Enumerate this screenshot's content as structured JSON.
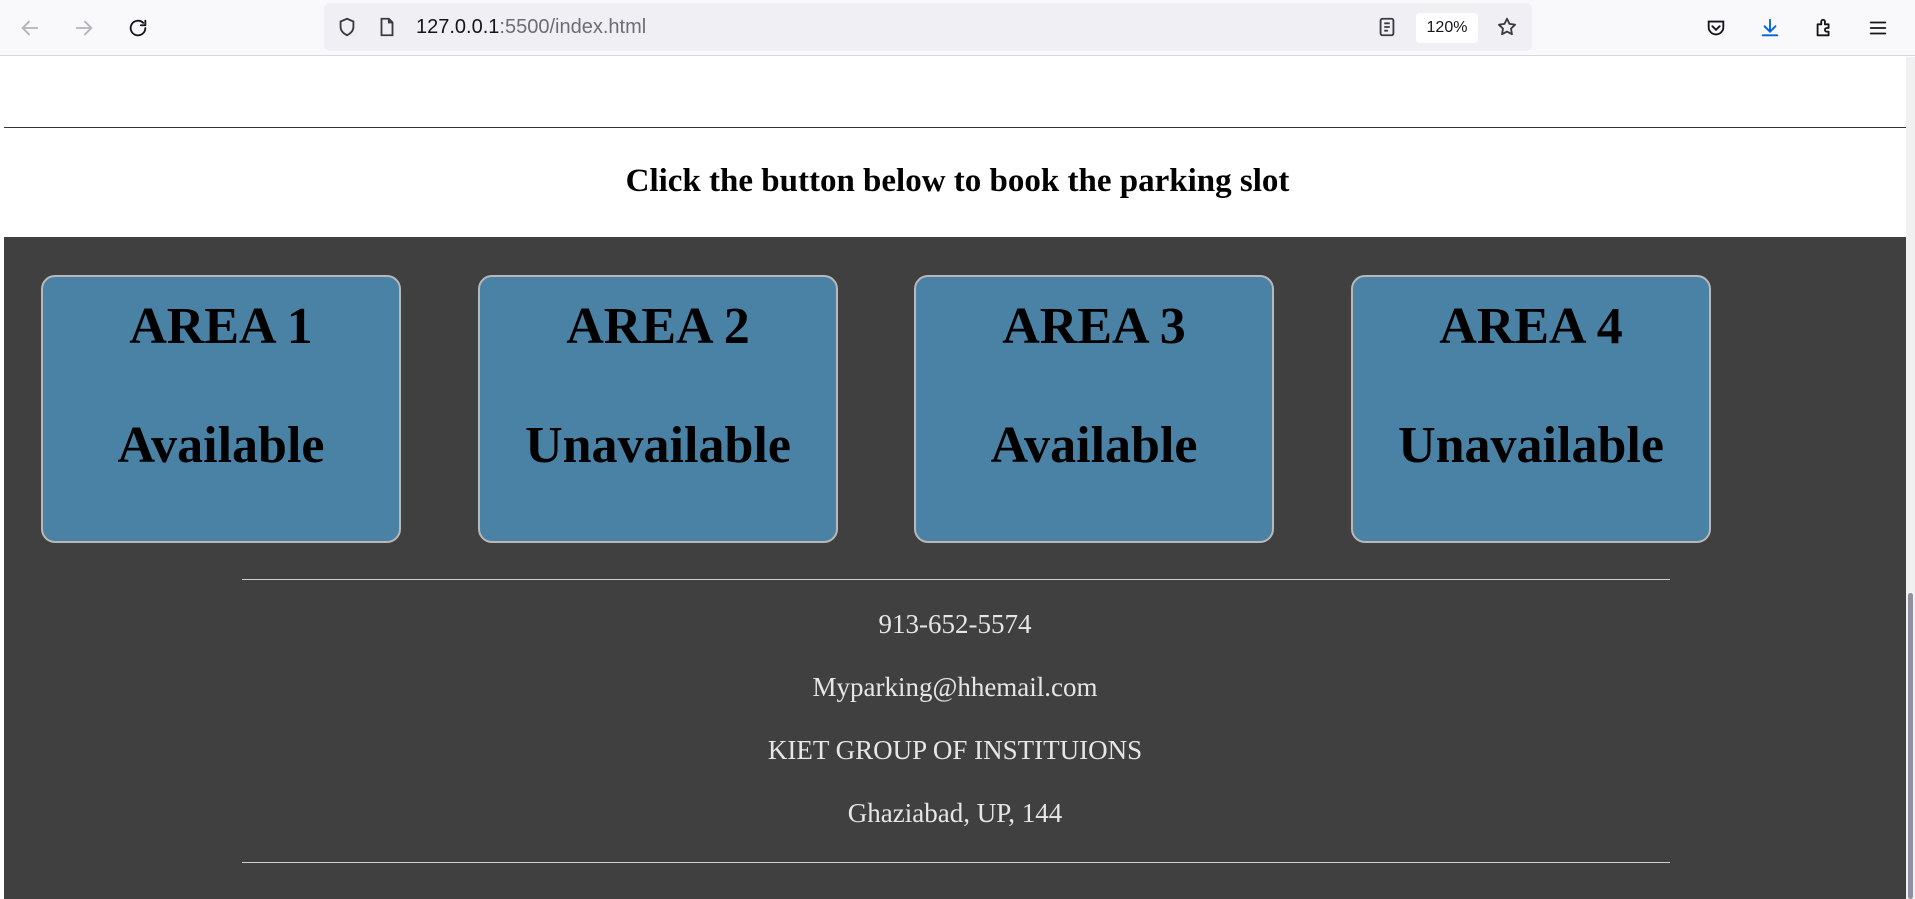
{
  "browser": {
    "url_host": "127.0.0.1",
    "url_path": ":5500/index.html",
    "zoom": "120%",
    "icons": [
      "back-icon",
      "forward-icon",
      "reload-icon",
      "shield-icon",
      "page-icon",
      "reader-view-icon",
      "bookmark-star-icon",
      "pocket-icon",
      "download-icon",
      "extensions-icon",
      "menu-icon"
    ]
  },
  "page": {
    "heading": "Click the button below to book the parking slot",
    "areas": [
      {
        "title": "AREA 1",
        "status": "Available"
      },
      {
        "title": "AREA 2",
        "status": "Unavailable"
      },
      {
        "title": "AREA 3",
        "status": "Available"
      },
      {
        "title": "AREA 4",
        "status": "Unavailable"
      }
    ],
    "footer": {
      "phone": "913-652-5574",
      "email": "Myparking@hhemail.com",
      "org": "KIET GROUP OF INSTITUIONS",
      "address": "Ghaziabad, UP, 144"
    }
  },
  "colors": {
    "dark_background": "#404040",
    "area_button": "#4a82a5",
    "footer_text": "#e6e6e6"
  }
}
